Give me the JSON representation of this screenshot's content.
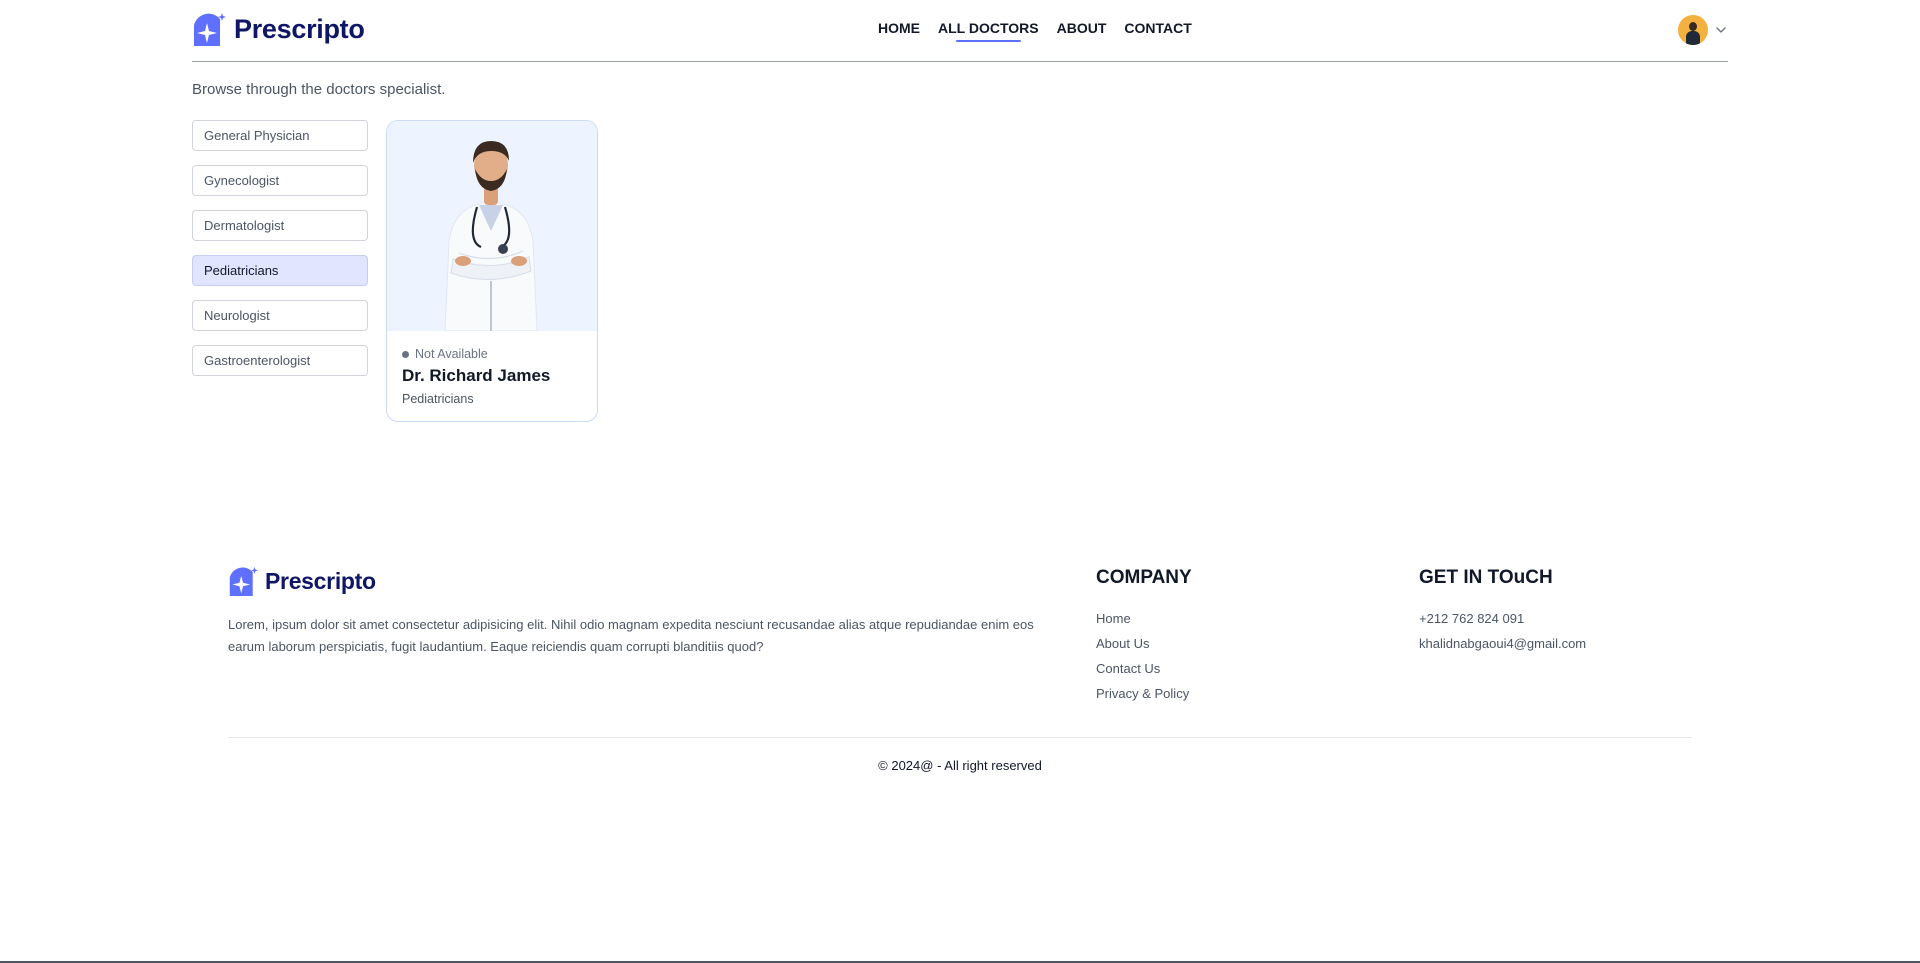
{
  "brand": {
    "name": "Prescripto",
    "accent": "#5f6fff",
    "navy": "#0f1666"
  },
  "nav": {
    "items": [
      {
        "label": "HOME"
      },
      {
        "label": "ALL DOCTORS"
      },
      {
        "label": "ABOUT"
      },
      {
        "label": "CONTACT"
      }
    ],
    "active": "ALL DOCTORS"
  },
  "page": {
    "subtitle": "Browse through the doctors specialist."
  },
  "filters": {
    "items": [
      {
        "label": "General Physician"
      },
      {
        "label": "Gynecologist"
      },
      {
        "label": "Dermatologist"
      },
      {
        "label": "Pediatricians"
      },
      {
        "label": "Neurologist"
      },
      {
        "label": "Gastroenterologist"
      }
    ],
    "active": "Pediatricians"
  },
  "doctors": [
    {
      "status": "Not Available",
      "status_color": "#6b7280",
      "name": "Dr. Richard James",
      "speciality": "Pediatricians"
    }
  ],
  "footer": {
    "description": "Lorem, ipsum dolor sit amet consectetur adipisicing elit. Nihil odio magnam expedita nesciunt recusandae alias atque repudiandae enim eos earum laborum perspiciatis, fugit laudantium. Eaque reiciendis quam corrupti blanditiis quod?",
    "company": {
      "title": "COMPANY",
      "links": [
        "Home",
        "About Us",
        "Contact Us",
        "Privacy & Policy"
      ]
    },
    "contact": {
      "title": "GET IN TOuCH",
      "phone": "+212 762 824 091",
      "email": "khalidnabgaoui4@gmail.com"
    },
    "copyright": "© 2024@ - All right reserved"
  }
}
